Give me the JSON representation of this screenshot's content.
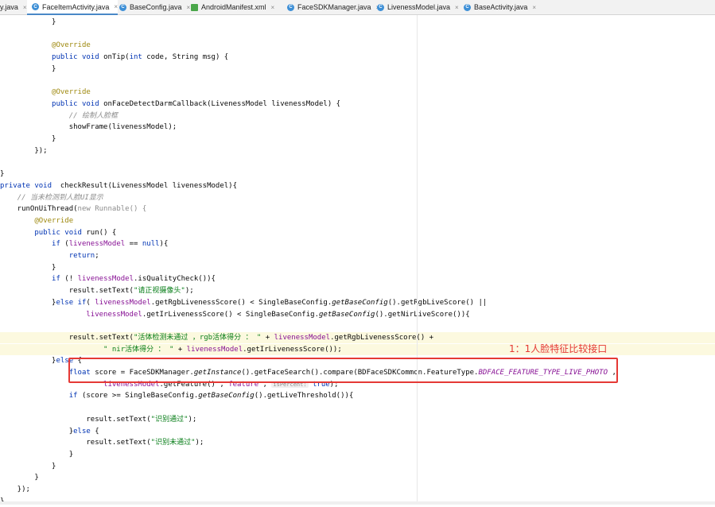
{
  "tabs": [
    {
      "label": "y.java",
      "icon": "none",
      "active": false
    },
    {
      "label": "FaceItemActivity.java",
      "icon": "java-class-icon",
      "active": true
    },
    {
      "label": "BaseConfig.java",
      "icon": "java-class-icon",
      "active": false
    },
    {
      "label": "AndroidManifest.xml",
      "icon": "xml-file-icon",
      "active": false
    },
    {
      "label": "FaceSDKManager.java",
      "icon": "java-class-icon",
      "active": false
    },
    {
      "label": "LivenessModel.java",
      "icon": "java-class-icon",
      "active": false
    },
    {
      "label": "BaseActivity.java",
      "icon": "java-class-icon",
      "active": false
    }
  ],
  "close_glyph": "×",
  "class_icon_letter": "C",
  "code_lines": [
    [
      {
        "t": "            }"
      }
    ],
    [],
    [
      {
        "t": "            "
      },
      {
        "t": "@Override",
        "c": "ann"
      }
    ],
    [
      {
        "t": "            "
      },
      {
        "t": "public void ",
        "c": "kw"
      },
      {
        "t": "onTip("
      },
      {
        "t": "int ",
        "c": "kw"
      },
      {
        "t": "code, String msg) {"
      }
    ],
    [
      {
        "t": "            }"
      }
    ],
    [],
    [
      {
        "t": "            "
      },
      {
        "t": "@Override",
        "c": "ann"
      }
    ],
    [
      {
        "t": "            "
      },
      {
        "t": "public void ",
        "c": "kw"
      },
      {
        "t": "onFaceDetectDarmCallback(LivenessModel livenessModel) {"
      }
    ],
    [
      {
        "t": "                "
      },
      {
        "t": "// 绘制人脸框",
        "c": "cm"
      }
    ],
    [
      {
        "t": "                showFrame(livenessModel);"
      }
    ],
    [
      {
        "t": "            }"
      }
    ],
    [
      {
        "t": "        });"
      }
    ],
    [],
    [
      {
        "t": "}"
      }
    ],
    [
      {
        "t": "private void  ",
        "c": "kw"
      },
      {
        "t": "checkResult(LivenessModel livenessModel){"
      }
    ],
    [
      {
        "t": "    "
      },
      {
        "t": "// 当未检测到人脸UI显示",
        "c": "cm"
      }
    ],
    [
      {
        "t": "    runOnUiThread("
      },
      {
        "t": "new Runnable() {",
        "c": "dim"
      }
    ],
    [
      {
        "t": "        "
      },
      {
        "t": "@Override",
        "c": "ann"
      }
    ],
    [
      {
        "t": "        "
      },
      {
        "t": "public void ",
        "c": "kw"
      },
      {
        "t": "run() {"
      }
    ],
    [
      {
        "t": "            "
      },
      {
        "t": "if ",
        "c": "kw"
      },
      {
        "t": "("
      },
      {
        "t": "livenessModel",
        "c": "fld"
      },
      {
        "t": " == "
      },
      {
        "t": "null",
        "c": "kw"
      },
      {
        "t": "){"
      }
    ],
    [
      {
        "t": "                "
      },
      {
        "t": "return",
        "c": "kw"
      },
      {
        "t": ";"
      }
    ],
    [
      {
        "t": "            }"
      }
    ],
    [
      {
        "t": "            "
      },
      {
        "t": "if ",
        "c": "kw"
      },
      {
        "t": "(! "
      },
      {
        "t": "livenessModel",
        "c": "fld"
      },
      {
        "t": ".isQualityCheck()){"
      }
    ],
    [
      {
        "t": "                result.setText("
      },
      {
        "t": "\"请正视摄像头\"",
        "c": "str"
      },
      {
        "t": ");"
      }
    ],
    [
      {
        "t": "            }"
      },
      {
        "t": "else if",
        "c": "kw"
      },
      {
        "t": "( "
      },
      {
        "t": "livenessModel",
        "c": "fld"
      },
      {
        "t": ".getRgbLivenessScore() < SingleBaseConfig."
      },
      {
        "t": "getBaseConfig",
        "c": "st"
      },
      {
        "t": "().getRgbLiveScore() ||"
      }
    ],
    [
      {
        "t": "                    "
      },
      {
        "t": "livenessModel",
        "c": "fld"
      },
      {
        "t": ".getIrLivenessScore() < SingleBaseConfig."
      },
      {
        "t": "getBaseConfig",
        "c": "st"
      },
      {
        "t": "().getNirLiveScore()){"
      }
    ],
    [],
    [
      {
        "t": "                result.setText("
      },
      {
        "t": "\"活体检测未通过 ，rgb活体得分 ： \"",
        "c": "str"
      },
      {
        "t": " + "
      },
      {
        "t": "livenessModel",
        "c": "fld"
      },
      {
        "t": ".getRgbLivenessScore() +"
      }
    ],
    [
      {
        "t": "                        "
      },
      {
        "t": "\" nir活体得分 ： \"",
        "c": "str"
      },
      {
        "t": " + "
      },
      {
        "t": "livenessModel",
        "c": "fld"
      },
      {
        "t": ".getIrLivenessScore());"
      }
    ],
    [
      {
        "t": "            }"
      },
      {
        "t": "else ",
        "c": "kw"
      },
      {
        "t": "{"
      }
    ],
    [
      {
        "t": "                "
      },
      {
        "t": "float ",
        "c": "kw"
      },
      {
        "t": "score = FaceSDKManager."
      },
      {
        "t": "getInstance",
        "c": "st"
      },
      {
        "t": "().getFaceSearch().compare(BDFaceSDKCommon.FeatureType."
      },
      {
        "t": "BDFACE_FEATURE_TYPE_LIVE_PHOTO",
        "c": "cst"
      },
      {
        "t": " ,"
      }
    ],
    [
      {
        "t": "                        "
      },
      {
        "t": "livenessModel",
        "c": "fld"
      },
      {
        "t": ".getFeature() , "
      },
      {
        "t": "feature",
        "c": "fld"
      },
      {
        "t": " , "
      },
      {
        "t": "isPercent:",
        "c": "hint"
      },
      {
        "t": " "
      },
      {
        "t": "true",
        "c": "kw"
      },
      {
        "t": ");"
      }
    ],
    [
      {
        "t": "                "
      },
      {
        "t": "if ",
        "c": "kw"
      },
      {
        "t": "(score >= SingleBaseConfig."
      },
      {
        "t": "getBaseConfig",
        "c": "st"
      },
      {
        "t": "().getLiveThreshold()){"
      }
    ],
    [],
    [
      {
        "t": "                    result.setText("
      },
      {
        "t": "\"识别通过\"",
        "c": "str"
      },
      {
        "t": ");"
      }
    ],
    [
      {
        "t": "                }"
      },
      {
        "t": "else ",
        "c": "kw"
      },
      {
        "t": "{"
      }
    ],
    [
      {
        "t": "                    result.setText("
      },
      {
        "t": "\"识别未通过\"",
        "c": "str"
      },
      {
        "t": ");"
      }
    ],
    [
      {
        "t": "                }"
      }
    ],
    [
      {
        "t": "            }"
      }
    ],
    [
      {
        "t": "        }"
      }
    ],
    [
      {
        "t": "    });"
      }
    ],
    [
      {
        "t": "}"
      }
    ]
  ],
  "highlighted_lines": [
    27,
    28
  ],
  "annotation": {
    "label": "1：1人脸特征比较接口",
    "color": "#e53935"
  }
}
